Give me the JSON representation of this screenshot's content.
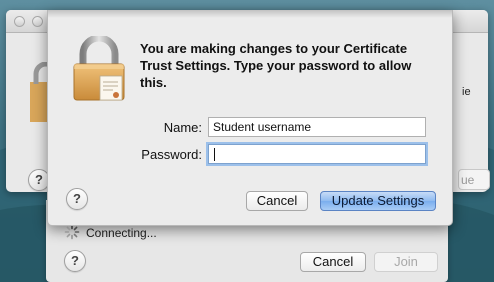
{
  "background_window": {
    "partial_side_text": "ie",
    "partial_button_label": "ue",
    "help_label": "?"
  },
  "dialog": {
    "message": "You are making changes to your Certificate Trust Settings. Type your password to allow this.",
    "name_label": "Name:",
    "name_value": "Student username",
    "password_label": "Password:",
    "password_value": "",
    "help_label": "?",
    "cancel_label": "Cancel",
    "update_label": "Update Settings"
  },
  "connection_panel": {
    "status_text": "Connecting...",
    "help_label": "?",
    "cancel_label": "Cancel",
    "join_label": "Join"
  },
  "icons": {
    "lock": "lock-certificate-icon",
    "spinner": "spinner-icon",
    "help": "question-mark-icon"
  },
  "colors": {
    "primary_button": "#8fbaf0",
    "focus_ring": "#9cc0ea"
  }
}
